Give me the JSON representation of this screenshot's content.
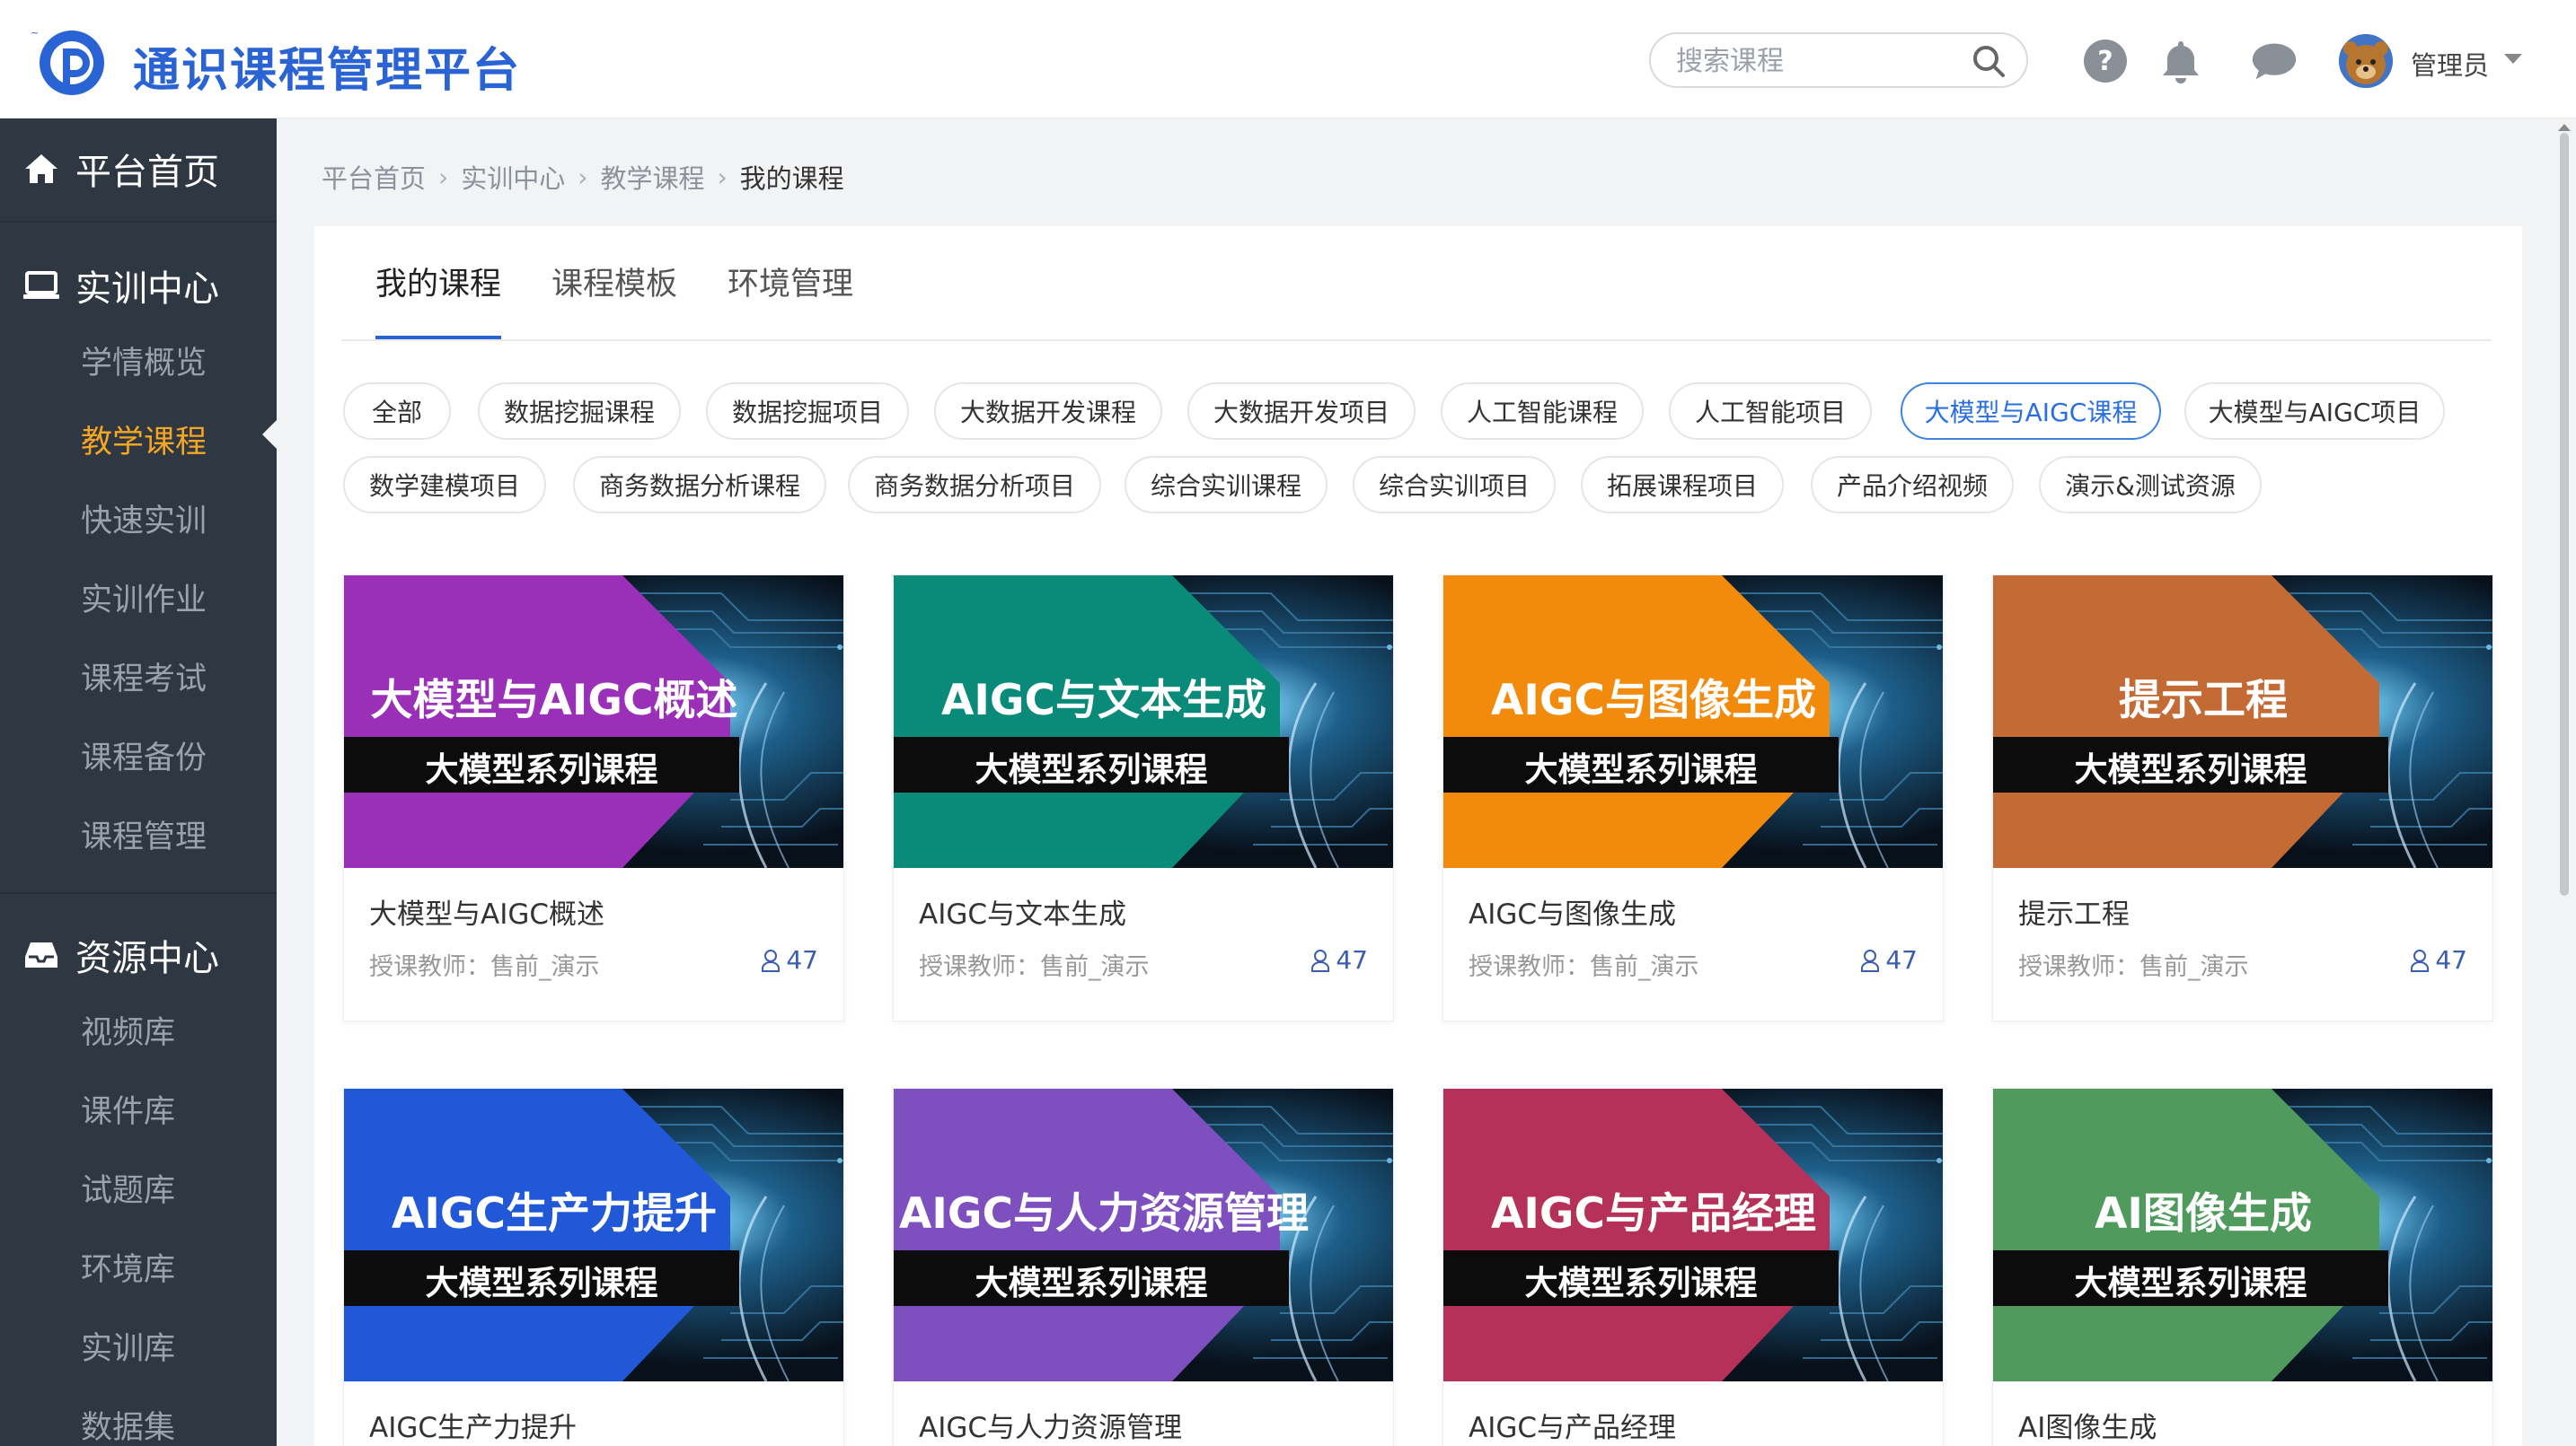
{
  "header": {
    "brand": "通识课程管理平台",
    "search_placeholder": "搜索课程",
    "username": "管理员"
  },
  "sidebar": {
    "home": "平台首页",
    "training_center": "实训中心",
    "training_items": [
      "学情概览",
      "教学课程",
      "快速实训",
      "实训作业",
      "课程考试",
      "课程备份",
      "课程管理"
    ],
    "active_item": "教学课程",
    "resource_center": "资源中心",
    "resource_items": [
      "视频库",
      "课件库",
      "试题库",
      "环境库",
      "实训库",
      "数据集"
    ]
  },
  "breadcrumb": [
    "平台首页",
    "实训中心",
    "教学课程",
    "我的课程"
  ],
  "tabs": [
    "我的课程",
    "课程模板",
    "环境管理"
  ],
  "active_tab": "我的课程",
  "categories": [
    "全部",
    "数据挖掘课程",
    "数据挖掘项目",
    "大数据开发课程",
    "大数据开发项目",
    "人工智能课程",
    "人工智能项目",
    "大模型与AIGC课程",
    "大模型与AIGC项目",
    "数学建模项目",
    "商务数据分析课程",
    "商务数据分析项目",
    "综合实训课程",
    "综合实训项目",
    "拓展课程项目",
    "产品介绍视频",
    "演示&测试资源"
  ],
  "active_category": "大模型与AIGC课程",
  "series_subtitle": "大模型系列课程",
  "teacher_label": "授课教师：售前_演示",
  "courses": [
    {
      "title": "大模型与AIGC概述",
      "thumb_title": "大模型与AIGC概述",
      "count": "47",
      "color": "#9a2fb8"
    },
    {
      "title": "AIGC与文本生成",
      "thumb_title": "AIGC与文本生成",
      "count": "47",
      "color": "#0a8a78"
    },
    {
      "title": "AIGC与图像生成",
      "thumb_title": "AIGC与图像生成",
      "count": "47",
      "color": "#f28a0c"
    },
    {
      "title": "提示工程",
      "thumb_title": "提示工程",
      "count": "47",
      "color": "#c46a35"
    },
    {
      "title": "AIGC生产力提升",
      "thumb_title": "AIGC生产力提升",
      "count": "",
      "color": "#2058d8"
    },
    {
      "title": "AIGC与人力资源管理",
      "thumb_title": "AIGC与人力资源管理",
      "count": "",
      "color": "#7e4fbf"
    },
    {
      "title": "AIGC与产品经理",
      "thumb_title": "AIGC与产品经理",
      "count": "",
      "color": "#b6315a"
    },
    {
      "title": "AI图像生成",
      "thumb_title": "AI图像生成",
      "count": "",
      "color": "#4f9a5c"
    }
  ]
}
